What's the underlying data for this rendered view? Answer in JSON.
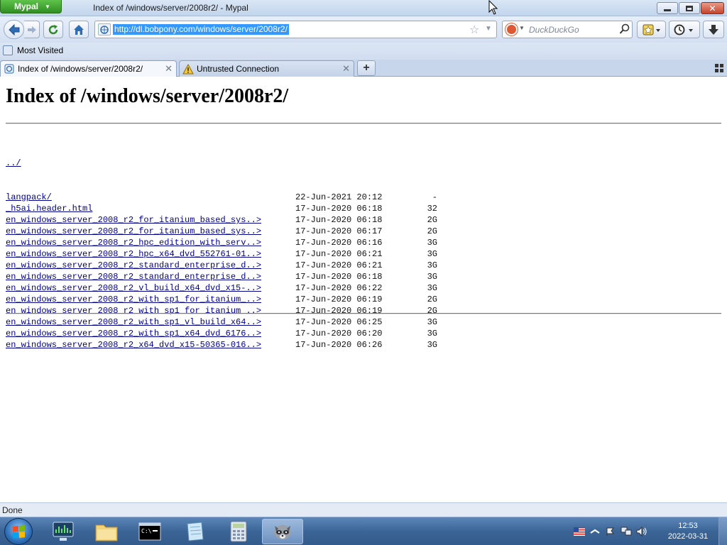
{
  "window": {
    "app_menu_label": "Mypal",
    "title": "Index of /windows/server/2008r2/ - Mypal"
  },
  "navbar": {
    "url": "http://dl.bobpony.com/windows/server/2008r2/",
    "search_placeholder": "DuckDuckGo",
    "icons": [
      "back-arrow-icon",
      "forward-arrow-icon",
      "reload-icon",
      "home-icon",
      "bookmark-star-icon",
      "duckduckgo-icon",
      "search-icon",
      "bookmarks-icon",
      "history-clock-icon",
      "download-arrow-icon"
    ]
  },
  "bookmarks_bar": {
    "most_visited": "Most Visited"
  },
  "tabs": [
    {
      "label": "Index of /windows/server/2008r2/",
      "icon": "page-icon",
      "active": true
    },
    {
      "label": "Untrusted Connection",
      "icon": "warning-icon",
      "active": false
    }
  ],
  "page": {
    "heading": "Index of /windows/server/2008r2/",
    "parent_link": "../",
    "entries": [
      {
        "name": "langpack/",
        "date": "22-Jun-2021 20:12",
        "size": "-"
      },
      {
        "name": "_h5ai.header.html",
        "date": "17-Jun-2020 06:18",
        "size": "32"
      },
      {
        "name": "en_windows_server_2008_r2_for_itanium_based_sys..>",
        "date": "17-Jun-2020 06:18",
        "size": "2G"
      },
      {
        "name": "en_windows_server_2008_r2_for_itanium_based_sys..>",
        "date": "17-Jun-2020 06:17",
        "size": "2G"
      },
      {
        "name": "en_windows_server_2008_r2_hpc_edition_with_serv..>",
        "date": "17-Jun-2020 06:16",
        "size": "3G"
      },
      {
        "name": "en_windows_server_2008_r2_hpc_x64_dvd_552761-01..>",
        "date": "17-Jun-2020 06:21",
        "size": "3G"
      },
      {
        "name": "en_windows_server_2008_r2_standard_enterprise_d..>",
        "date": "17-Jun-2020 06:21",
        "size": "3G"
      },
      {
        "name": "en_windows_server_2008_r2_standard_enterprise_d..>",
        "date": "17-Jun-2020 06:18",
        "size": "3G"
      },
      {
        "name": "en_windows_server_2008_r2_vl_build_x64_dvd_x15-..>",
        "date": "17-Jun-2020 06:22",
        "size": "3G"
      },
      {
        "name": "en_windows_server_2008_r2_with_sp1_for_itanium_..>",
        "date": "17-Jun-2020 06:19",
        "size": "2G"
      },
      {
        "name": "en_windows_server_2008_r2_with_sp1_for_itanium_..>",
        "date": "17-Jun-2020 06:19",
        "size": "2G"
      },
      {
        "name": "en_windows_server_2008_r2_with_sp1_vl_build_x64..>",
        "date": "17-Jun-2020 06:25",
        "size": "3G"
      },
      {
        "name": "en_windows_server_2008_r2_with_sp1_x64_dvd_6176..>",
        "date": "17-Jun-2020 06:20",
        "size": "3G"
      },
      {
        "name": "en_windows_server_2008_r2_x64_dvd_x15-50365-016..>",
        "date": "17-Jun-2020 06:26",
        "size": "3G"
      }
    ]
  },
  "status_bar": {
    "text": "Done"
  },
  "taskbar": {
    "pinned": [
      {
        "name": "task-manager-icon",
        "active": false
      },
      {
        "name": "file-explorer-icon",
        "active": false
      },
      {
        "name": "command-prompt-icon",
        "active": false
      },
      {
        "name": "notepad-icon",
        "active": false
      },
      {
        "name": "calculator-icon",
        "active": false
      },
      {
        "name": "mypal-raccoon-icon",
        "active": true
      }
    ],
    "tray_icons": [
      "us-flag-language-icon",
      "show-hidden-icons-icon",
      "action-center-icon",
      "network-icon",
      "volume-icon"
    ],
    "time": "12:53",
    "date": "2022-03-31"
  },
  "colors": {
    "link": "#00008b",
    "url_selection": "#3399ff",
    "app_menu": "#3a9a2c",
    "close_button": "#c5432b",
    "taskbar": "#3c6597"
  }
}
